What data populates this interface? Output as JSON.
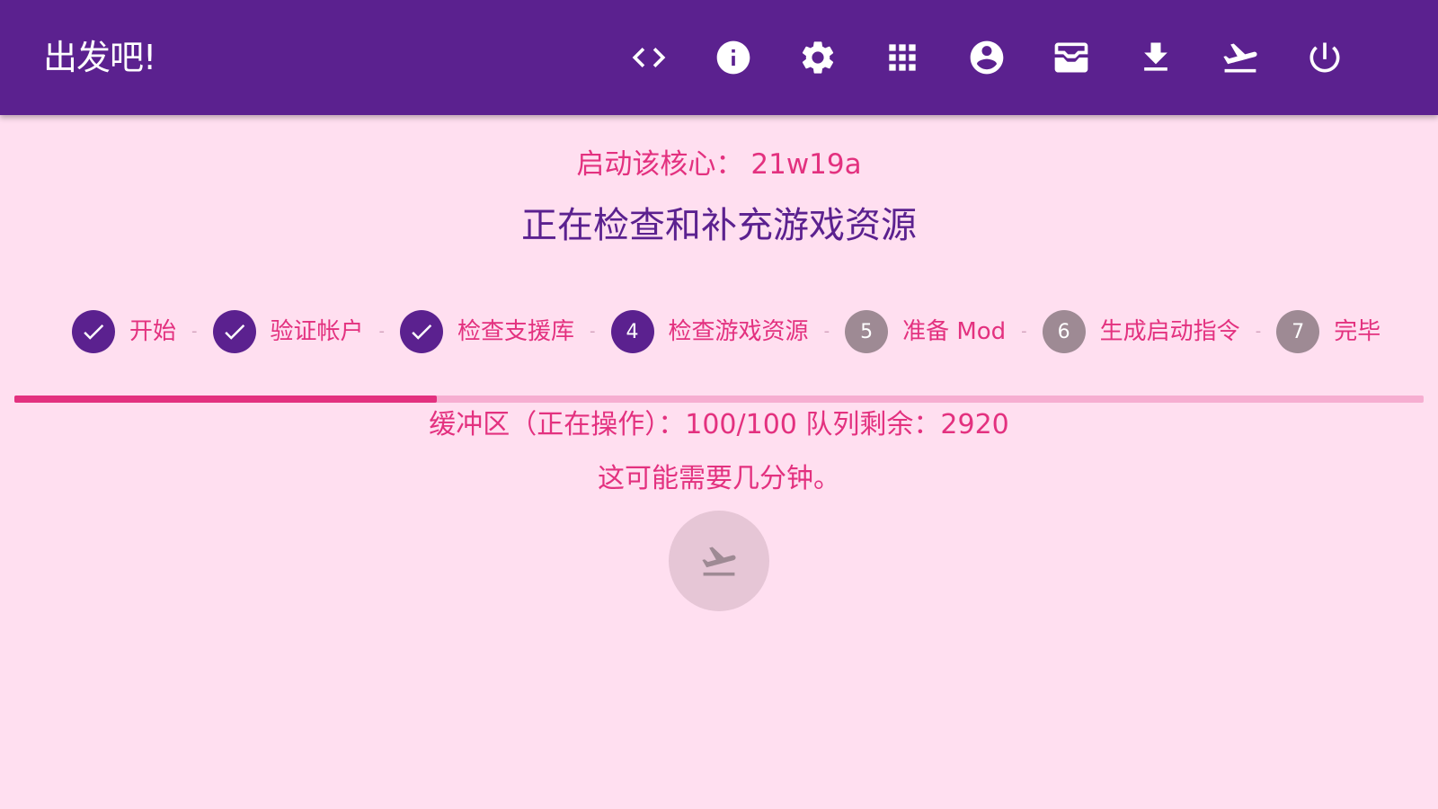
{
  "appbar": {
    "title": "出发吧!",
    "actions": [
      {
        "icon": "code-icon"
      },
      {
        "icon": "info-icon"
      },
      {
        "icon": "settings-icon"
      },
      {
        "icon": "apps-grid-icon"
      },
      {
        "icon": "account-icon"
      },
      {
        "icon": "inbox-tray-icon"
      },
      {
        "icon": "download-icon"
      },
      {
        "icon": "flight-takeoff-icon"
      },
      {
        "icon": "power-icon"
      }
    ]
  },
  "main": {
    "core_label": "启动该核心：",
    "core_version": "21w19a",
    "status_heading": "正在检查和补充游戏资源",
    "steps": [
      {
        "number": "1",
        "label": "开始",
        "state": "done"
      },
      {
        "number": "2",
        "label": "验证帐户",
        "state": "done"
      },
      {
        "number": "3",
        "label": "检查支援库",
        "state": "done"
      },
      {
        "number": "4",
        "label": "检查游戏资源",
        "state": "active"
      },
      {
        "number": "5",
        "label": "准备 Mod",
        "state": "pending"
      },
      {
        "number": "6",
        "label": "生成启动指令",
        "state": "pending"
      },
      {
        "number": "7",
        "label": "完毕",
        "state": "pending"
      }
    ],
    "step_separator": "-",
    "progress_fraction": 0.3,
    "buffer_text": "缓冲区（正在操作）：100/100 队列剩余：2920",
    "hint_text": "这可能需要几分钟。",
    "launch_button_icon": "flight-takeoff-icon",
    "launch_button_enabled": false
  },
  "colors": {
    "primary": "#5b218f",
    "accent": "#e3317f",
    "background": "#ffdff0",
    "pending_step": "#9e8a94",
    "progress_track": "#f6aed1"
  }
}
